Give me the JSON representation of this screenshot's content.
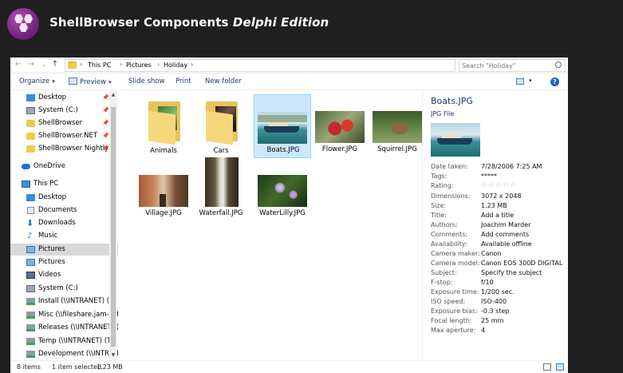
{
  "banner": {
    "brand": "ShellBrowser Components",
    "edition": "Delphi Edition"
  },
  "address": {
    "crumbs": [
      "This PC",
      "Pictures",
      "Holiday"
    ],
    "search_placeholder": "Search \"Holiday\""
  },
  "toolbar": {
    "organize": "Organize",
    "preview": "Preview",
    "slideshow": "Slide show",
    "print": "Print",
    "new_folder": "New folder",
    "help": "?"
  },
  "nav": {
    "quick": [
      "Desktop",
      "System (C:)",
      "ShellBrowser",
      "ShellBrowser.NET",
      "ShellBrowser Nightly"
    ],
    "onedrive": "OneDrive",
    "thispc": "This PC",
    "pc_items": [
      "Desktop",
      "Documents",
      "Downloads",
      "Music",
      "Pictures",
      "Pictures",
      "Videos",
      "System (C:)",
      "Install (\\\\INTRANET) (I:)",
      "Misc (\\\\fileshare.jam-software.com",
      "Releases (\\\\INTRANET) (R:)",
      "Temp (\\\\INTRANET) (T:)",
      "Development (\\\\INTRANET)"
    ]
  },
  "files": [
    {
      "name": "Animals",
      "kind": "folder"
    },
    {
      "name": "Cars",
      "kind": "folder"
    },
    {
      "name": "Boats.JPG",
      "kind": "image"
    },
    {
      "name": "Flower.JPG",
      "kind": "image"
    },
    {
      "name": "Squirrel.JPG",
      "kind": "image"
    },
    {
      "name": "Village.JPG",
      "kind": "image"
    },
    {
      "name": "Waterfall.JPG",
      "kind": "image"
    },
    {
      "name": "WaterLilly.JPG",
      "kind": "image"
    }
  ],
  "details": {
    "title": "Boats.JPG",
    "type": "JPG File",
    "props": [
      {
        "k": "Date taken:",
        "v": "7/28/2006 7:25 AM"
      },
      {
        "k": "Tags:",
        "v": "*****"
      },
      {
        "k": "Rating:",
        "v": "☆☆☆☆☆"
      },
      {
        "k": "Dimensions:",
        "v": "3072 x 2048"
      },
      {
        "k": "Size:",
        "v": "1.23 MB"
      },
      {
        "k": "Title:",
        "v": "Add a title"
      },
      {
        "k": "Authors:",
        "v": "Joachim Marder"
      },
      {
        "k": "Comments:",
        "v": "Add comments"
      },
      {
        "k": "Availability:",
        "v": "Available offline"
      },
      {
        "k": "Camera maker:",
        "v": "Canon"
      },
      {
        "k": "Camera model:",
        "v": "Canon EOS 300D DIGITAL"
      },
      {
        "k": "Subject:",
        "v": "Specify the subject"
      },
      {
        "k": "F-stop:",
        "v": "f/10"
      },
      {
        "k": "Exposure time:",
        "v": "1/200 sec."
      },
      {
        "k": "ISO speed:",
        "v": "ISO-400"
      },
      {
        "k": "Exposure bias:",
        "v": "-0.3 step"
      },
      {
        "k": "Focal length:",
        "v": "25 mm"
      },
      {
        "k": "Max aperture:",
        "v": "4"
      }
    ]
  },
  "status": {
    "items": "8 items",
    "selected": "1 item selected",
    "size": "1.23 MB"
  }
}
